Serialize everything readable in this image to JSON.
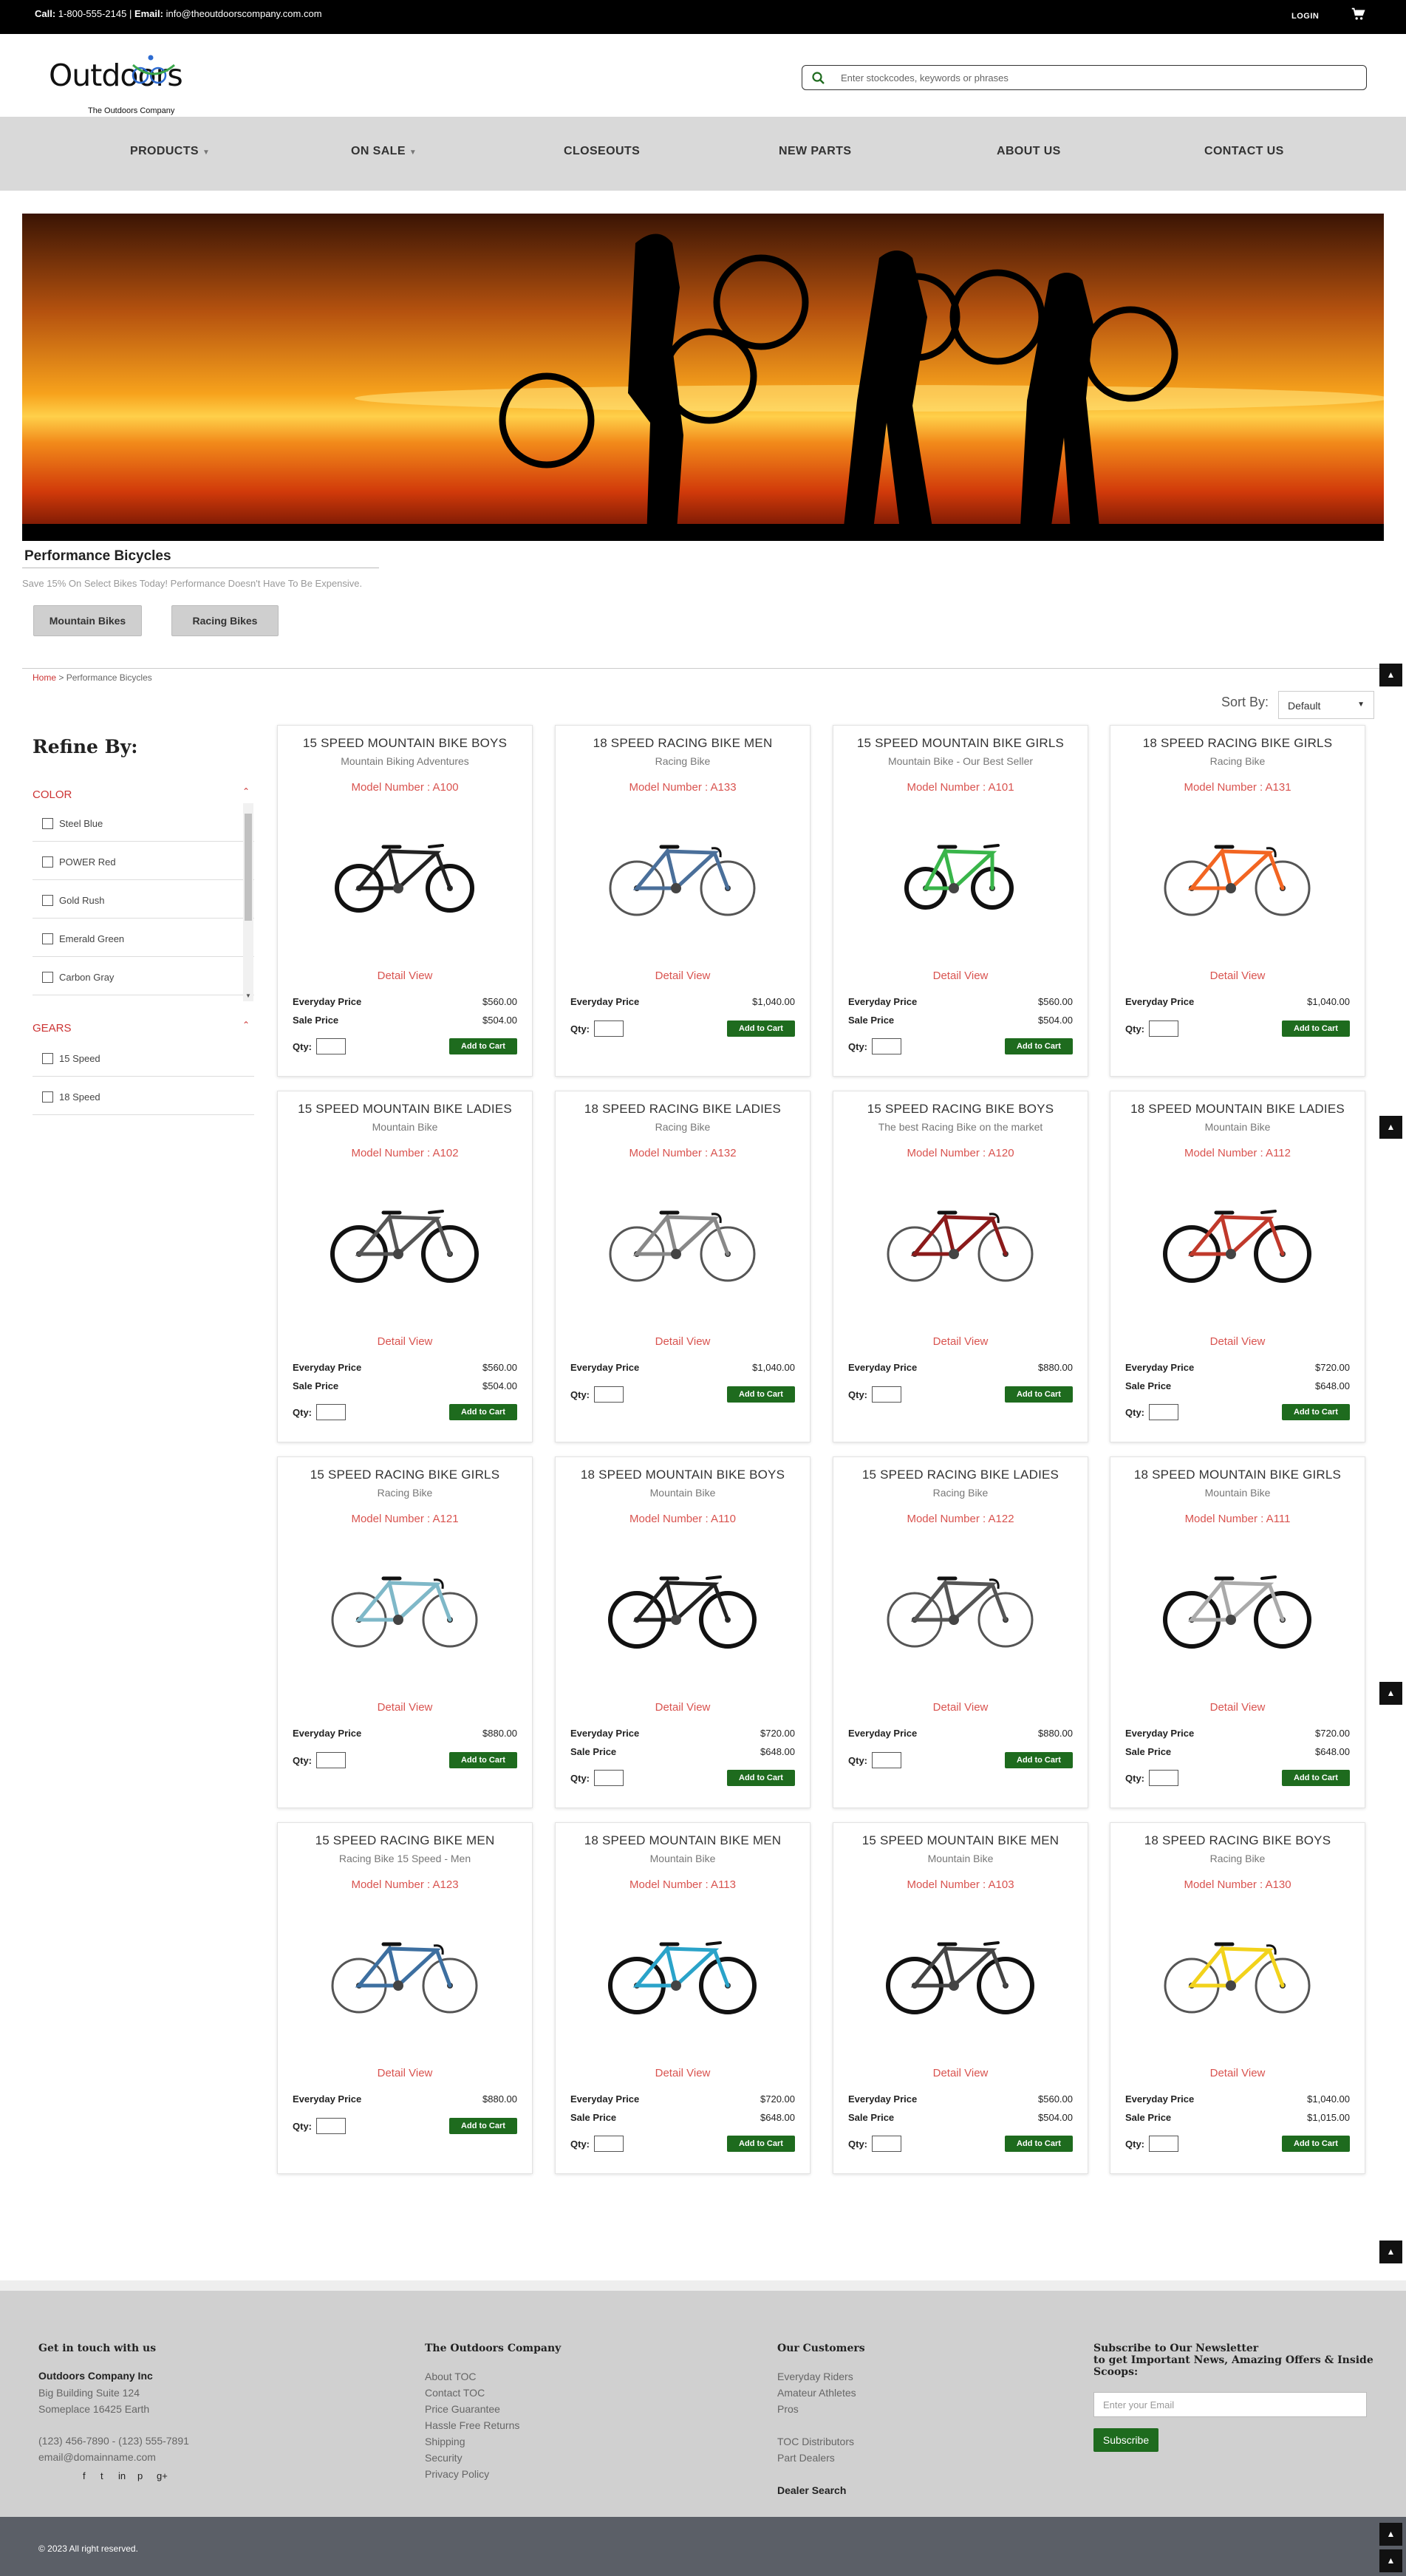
{
  "topbar": {
    "call_label": "Call:",
    "phone": "1-800-555-2145",
    "email_label": "Email:",
    "email": "info@theoutdoorscompany.com.com",
    "login": "LOGIN"
  },
  "header": {
    "logo_text": "Outdoors",
    "logo_tagline": "The Outdoors Company",
    "search_placeholder": "Enter stockcodes, keywords or phrases"
  },
  "nav": [
    {
      "label": "PRODUCTS",
      "dropdown": true
    },
    {
      "label": "ON SALE",
      "dropdown": true
    },
    {
      "label": "CLOSEOUTS",
      "dropdown": false
    },
    {
      "label": "NEW PARTS",
      "dropdown": false
    },
    {
      "label": "ABOUT US",
      "dropdown": false
    },
    {
      "label": "CONTACT US",
      "dropdown": false
    }
  ],
  "page": {
    "title": "Performance Bicycles",
    "subtitle": "Save 15% On Select Bikes Today! Performance Doesn't Have To Be Expensive.",
    "categories": [
      "Mountain Bikes",
      "Racing Bikes"
    ],
    "breadcrumb_home": "Home",
    "breadcrumb_sep": ">",
    "breadcrumb_current": "Performance Bicycles",
    "sort_label": "Sort By:",
    "sort_value": "Default",
    "back_to_top_icon": "caret-up-icon"
  },
  "sidebar": {
    "title": "Refine By:",
    "facets": [
      {
        "name": "COLOR",
        "options": [
          "Steel Blue",
          "POWER Red",
          "Gold Rush",
          "Emerald Green",
          "Carbon Gray"
        ]
      },
      {
        "name": "GEARS",
        "options": [
          "15 Speed",
          "18 Speed"
        ]
      }
    ]
  },
  "labels": {
    "detail_view": "Detail View",
    "everyday_price": "Everyday Price",
    "sale_price": "Sale Price",
    "qty": "Qty:",
    "add_to_cart": "Add to Cart"
  },
  "products": [
    {
      "name": "15 SPEED MOUNTAIN BIKE BOYS",
      "sub": "Mountain Biking Adventures",
      "model": "Model Number : A100",
      "everyday": "$560.00",
      "sale": "$504.00",
      "color": "#222222",
      "type": "bmx"
    },
    {
      "name": "18 SPEED RACING BIKE MEN",
      "sub": "Racing Bike",
      "model": "Model Number : A133",
      "everyday": "$1,040.00",
      "sale": null,
      "color": "#4a6f9a",
      "type": "road"
    },
    {
      "name": "15 SPEED MOUNTAIN BIKE GIRLS",
      "sub": "Mountain Bike - Our Best Seller",
      "model": "Model Number : A101",
      "everyday": "$560.00",
      "sale": "$504.00",
      "color": "#39b54a",
      "type": "kids"
    },
    {
      "name": "18 SPEED RACING BIKE GIRLS",
      "sub": "Racing Bike",
      "model": "Model Number : A131",
      "everyday": "$1,040.00",
      "sale": null,
      "color": "#f26522",
      "type": "road"
    },
    {
      "name": "15 SPEED MOUNTAIN BIKE LADIES",
      "sub": "Mountain Bike",
      "model": "Model Number : A102",
      "everyday": "$560.00",
      "sale": "$504.00",
      "color": "#555555",
      "type": "mtb"
    },
    {
      "name": "18 SPEED RACING BIKE LADIES",
      "sub": "Racing Bike",
      "model": "Model Number : A132",
      "everyday": "$1,040.00",
      "sale": null,
      "color": "#888888",
      "type": "road"
    },
    {
      "name": "15 SPEED RACING BIKE BOYS",
      "sub": "The best Racing Bike on the market",
      "model": "Model Number : A120",
      "everyday": "$880.00",
      "sale": null,
      "color": "#8b1a1a",
      "type": "road"
    },
    {
      "name": "18 SPEED MOUNTAIN BIKE LADIES",
      "sub": "Mountain Bike",
      "model": "Model Number : A112",
      "everyday": "$720.00",
      "sale": "$648.00",
      "color": "#c0392b",
      "type": "mtb"
    },
    {
      "name": "15 SPEED RACING BIKE GIRLS",
      "sub": "Racing Bike",
      "model": "Model Number : A121",
      "everyday": "$880.00",
      "sale": null,
      "color": "#7fb8c8",
      "type": "road"
    },
    {
      "name": "18 SPEED MOUNTAIN BIKE BOYS",
      "sub": "Mountain Bike",
      "model": "Model Number : A110",
      "everyday": "$720.00",
      "sale": "$648.00",
      "color": "#222222",
      "type": "mtb"
    },
    {
      "name": "15 SPEED RACING BIKE LADIES",
      "sub": "Racing Bike",
      "model": "Model Number : A122",
      "everyday": "$880.00",
      "sale": null,
      "color": "#555555",
      "type": "road"
    },
    {
      "name": "18 SPEED MOUNTAIN BIKE GIRLS",
      "sub": "Mountain Bike",
      "model": "Model Number : A111",
      "everyday": "$720.00",
      "sale": "$648.00",
      "color": "#aaaaaa",
      "type": "mtb"
    },
    {
      "name": "15 SPEED RACING BIKE MEN",
      "sub": "Racing Bike 15 Speed - Men",
      "model": "Model Number : A123",
      "everyday": "$880.00",
      "sale": null,
      "color": "#3d6fa0",
      "type": "road"
    },
    {
      "name": "18 SPEED MOUNTAIN BIKE MEN",
      "sub": "Mountain Bike",
      "model": "Model Number : A113",
      "everyday": "$720.00",
      "sale": "$648.00",
      "color": "#2aa3c9",
      "type": "mtb"
    },
    {
      "name": "15 SPEED MOUNTAIN BIKE MEN",
      "sub": "Mountain Bike",
      "model": "Model Number : A103",
      "everyday": "$560.00",
      "sale": "$504.00",
      "color": "#444444",
      "type": "mtb"
    },
    {
      "name": "18 SPEED RACING BIKE BOYS",
      "sub": "Racing Bike",
      "model": "Model Number : A130",
      "everyday": "$1,040.00",
      "sale": "$1,015.00",
      "color": "#f2d21b",
      "type": "road"
    }
  ],
  "footer": {
    "col1": {
      "heading": "Get in touch with us",
      "company": "Outdoors Company Inc",
      "address1": "Big Building Suite 124",
      "address2": "Someplace 16425 Earth",
      "phones": "(123) 456-7890 - (123) 555-7891",
      "email": "email@domainname.com",
      "social": [
        "f",
        "t",
        "in",
        "p",
        "g+"
      ]
    },
    "col2": {
      "heading": "The Outdoors Company",
      "links": [
        "About TOC",
        "Contact TOC",
        "Price Guarantee",
        "Hassle Free Returns",
        "Shipping",
        "Security",
        "Privacy Policy"
      ]
    },
    "col3": {
      "heading": "Our Customers",
      "links": [
        "Everyday Riders",
        "Amateur Athletes",
        "Pros"
      ],
      "links2": [
        "TOC Distributors",
        "Part Dealers"
      ],
      "dealer": "Dealer Search"
    },
    "col4": {
      "heading1": "Subscribe to Our Newsletter",
      "heading2": "to get Important News, Amazing Offers & Inside Scoops:",
      "placeholder": "Enter your Email",
      "button": "Subscribe"
    },
    "copyright": "© 2023 All right reserved."
  }
}
